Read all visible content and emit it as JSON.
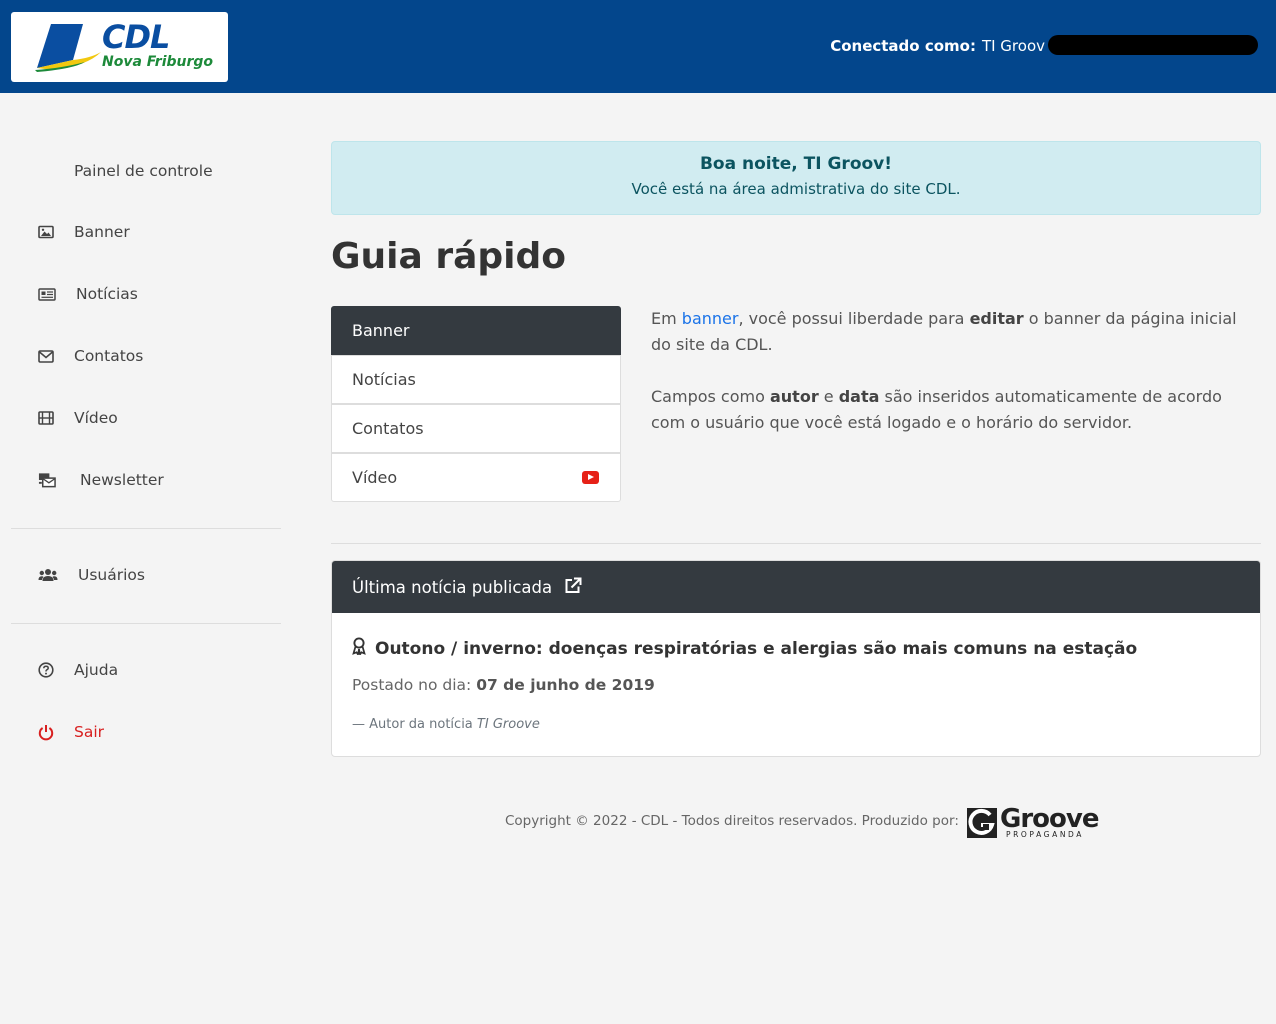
{
  "header": {
    "logo_text": "CDL",
    "logo_city": "Nova Friburgo",
    "connected_label": "Conectado como:",
    "connected_user": "TI Groov"
  },
  "sidebar": {
    "items": [
      {
        "label": "Painel de controle",
        "icon": "dashboard"
      },
      {
        "label": "Banner",
        "icon": "image-icon"
      },
      {
        "label": "Notícias",
        "icon": "newspaper-icon"
      },
      {
        "label": "Contatos",
        "icon": "envelope-icon"
      },
      {
        "label": "Vídeo",
        "icon": "film-icon"
      },
      {
        "label": "Newsletter",
        "icon": "mail-bulk-icon"
      },
      {
        "label": "Usuários",
        "icon": "users-icon"
      },
      {
        "label": "Ajuda",
        "icon": "question-circle-icon"
      },
      {
        "label": "Sair",
        "icon": "power-icon",
        "color": "#d81f1f"
      }
    ]
  },
  "alert": {
    "greeting": "Boa noite, TI Groov!",
    "message": "Você está na área admistrativa do site CDL."
  },
  "guide": {
    "title": "Guia rápido",
    "tabs": [
      "Banner",
      "Notícias",
      "Contatos",
      "Vídeo"
    ],
    "active_tab": "Banner",
    "p1_pre": "Em ",
    "p1_link": "banner",
    "p1_mid": ", você possui liberdade para ",
    "p1_bold": "editar",
    "p1_post": " o banner da página inicial do site da CDL.",
    "p2_pre": "Campos como ",
    "p2_b1": "autor",
    "p2_mid": " e ",
    "p2_b2": "data",
    "p2_post": " são inseridos automaticamente de acordo com o usuário que você está logado e o horário do servidor."
  },
  "latest_news": {
    "header": "Última notícia publicada",
    "title": "Outono / inverno: doenças respiratórias e alergias são mais comuns na estação",
    "date_label": "Postado no dia:",
    "date": "07 de junho de 2019",
    "author_label": "— Autor da notícia",
    "author": "TI Groove"
  },
  "footer": {
    "copyright": "Copyright © 2022 - CDL - Todos direitos reservados. Produzido por:",
    "brand": "Groove",
    "brand_sub": "PROPAGANDA"
  },
  "colors": {
    "header_bg": "#03468c",
    "alert_bg": "#d1ecf1",
    "dark": "#343a40",
    "danger": "#d81f1f",
    "link": "#1a73e8"
  }
}
